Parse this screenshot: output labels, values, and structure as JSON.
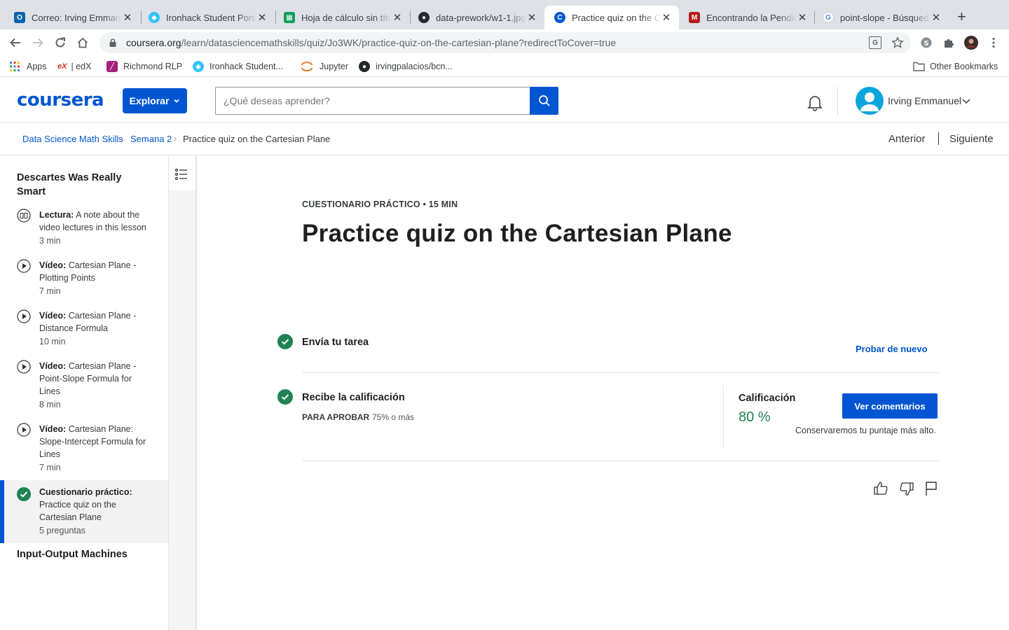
{
  "browser": {
    "tabs": [
      {
        "title": "Correo: Irving Emmanuel",
        "favicon": "outlook-icon",
        "color": "#0a64ad"
      },
      {
        "title": "Ironhack Student Portal",
        "favicon": "ironhack-icon",
        "color": "#32c3ff"
      },
      {
        "title": "Hoja de cálculo sin título",
        "favicon": "google-sheets-icon",
        "color": "#0f9d58"
      },
      {
        "title": "data-prework/w1-1.jpg",
        "favicon": "github-icon",
        "color": "#24292e"
      },
      {
        "title": "Practice quiz on the Cartesian Plane",
        "favicon": "coursera-icon",
        "color": "#0056d2",
        "active": true
      },
      {
        "title": "Encontrando la Pendiente",
        "favicon": "site-icon",
        "color": "#b71c1c"
      },
      {
        "title": "point-slope - Búsqueda",
        "favicon": "google-icon",
        "color": "#4285f4"
      }
    ],
    "url": {
      "host": "coursera.org",
      "path": "/learn/datasciencemathskills/quiz/Jo3WK/practice-quiz-on-the-cartesian-plane?redirectToCover=true"
    },
    "bookmarks": [
      {
        "label": "Apps",
        "icon": "apps-grid-icon"
      },
      {
        "label": "| edX",
        "icon": "edx-icon"
      },
      {
        "label": "Richmond RLP",
        "icon": "richmond-icon"
      },
      {
        "label": "Ironhack Student...",
        "icon": "ironhack-icon"
      },
      {
        "label": "Jupyter",
        "icon": "jupyter-icon"
      },
      {
        "label": "irvingpalacios/bcn...",
        "icon": "github-icon"
      }
    ],
    "other_bookmarks": "Other Bookmarks"
  },
  "header": {
    "logo": "coursera",
    "explore_label": "Explorar",
    "search_placeholder": "¿Qué deseas aprender?",
    "user_name": "Irving Emmanuel"
  },
  "breadcrumb": {
    "items": [
      "Data Science Math Skills",
      "Semana 2",
      "Practice quiz on the Cartesian Plane"
    ],
    "prev_label": "Anterior",
    "next_label": "Siguiente"
  },
  "sidebar": {
    "module_title": "Descartes Was Really Smart",
    "items": [
      {
        "type": "Lectura:",
        "title": "A note about the video lectures in this lesson",
        "meta": "3 min",
        "icon": "reading-icon"
      },
      {
        "type": "Vídeo:",
        "title": "Cartesian Plane - Plotting Points",
        "meta": "7 min",
        "icon": "play-icon"
      },
      {
        "type": "Vídeo:",
        "title": "Cartesian Plane - Distance Formula",
        "meta": "10 min",
        "icon": "play-icon"
      },
      {
        "type": "Vídeo:",
        "title": "Cartesian Plane - Point-Slope Formula for Lines",
        "meta": "8 min",
        "icon": "play-icon"
      },
      {
        "type": "Vídeo:",
        "title": "Cartesian Plane: Slope-Intercept Formula for Lines",
        "meta": "7 min",
        "icon": "play-icon"
      },
      {
        "type": "Cuestionario práctico:",
        "title": "Practice quiz on the Cartesian Plane",
        "meta": "5 preguntas",
        "icon": "check-circle-icon",
        "active": true
      }
    ],
    "next_module_title": "Input-Output Machines"
  },
  "main": {
    "kicker": "CUESTIONARIO PRÁCTICO • 15 MIN",
    "title": "Practice quiz on the Cartesian Plane",
    "step1_label": "Envía tu tarea",
    "retry_label": "Probar de nuevo",
    "step2_label": "Recibe la calificación",
    "pass_label": "PARA APROBAR",
    "pass_value": "75% o más",
    "grade_label": "Calificación",
    "grade_value": "80 %",
    "feedback_button": "Ver comentarios",
    "keep_note": "Conservaremos tu puntaje más alto."
  },
  "colors": {
    "brand": "#0056d2",
    "success": "#1f8354"
  }
}
